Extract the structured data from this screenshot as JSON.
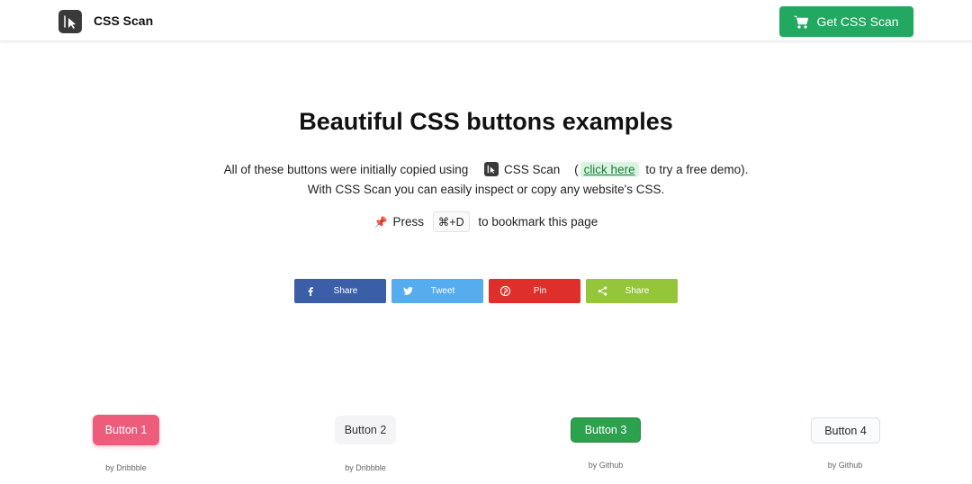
{
  "header": {
    "brand": "CSS Scan",
    "cta_label": "Get CSS Scan",
    "cta_color": "#22a860"
  },
  "hero": {
    "title": "Beautiful CSS buttons examples",
    "line1_prefix": "All of these buttons were initially copied using",
    "line1_brand": "CSS Scan",
    "line1_open": "(",
    "line1_link": "click here",
    "line1_suffix": "to try a free demo).",
    "line2": "With CSS Scan you can easily inspect or copy any website's CSS.",
    "bookmark_prefix": "Press",
    "bookmark_key": "⌘+D",
    "bookmark_suffix": "to bookmark this page"
  },
  "social": [
    {
      "label": "Share",
      "icon": "facebook-icon",
      "color": "#3b5ea8"
    },
    {
      "label": "Tweet",
      "icon": "twitter-icon",
      "color": "#55acee"
    },
    {
      "label": "Pin",
      "icon": "pinterest-icon",
      "color": "#df2f2a"
    },
    {
      "label": "Share",
      "icon": "share-icon",
      "color": "#95c53a"
    }
  ],
  "examples": [
    {
      "label": "Button 1",
      "credit": "by Dribbble",
      "color": "#ee5c7c"
    },
    {
      "label": "Button 2",
      "credit": "by Dribbble",
      "color": "#f4f3f6"
    },
    {
      "label": "Button 3",
      "credit": "by Github",
      "color": "#2ca14e"
    },
    {
      "label": "Button 4",
      "credit": "by Github",
      "color": "#fafbfc"
    }
  ]
}
